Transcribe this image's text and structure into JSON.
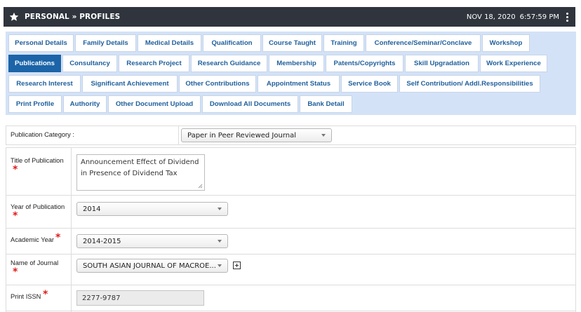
{
  "header": {
    "star_icon": "star-icon",
    "title": "PERSONAL » PROFILES",
    "date": "NOV 18, 2020",
    "time": "6:57:59 PM",
    "menu_icon": "kebab-menu-icon",
    "background": "#2f343d"
  },
  "tabs": {
    "row1": [
      "Personal Details",
      "Family Details",
      "Medical Details",
      "Qualification",
      "Course Taught",
      "Training",
      "Conference/Seminar/Conclave",
      "Workshop"
    ],
    "row2": [
      "Publications",
      "Consultancy",
      "Research Project",
      "Research Guidance",
      "Membership",
      "Patents/Copyrights",
      "Skill Upgradation",
      "Work Experience"
    ],
    "row3": [
      "Research Interest",
      "Significant Achievement",
      "Other Contributions",
      "Appointment Status",
      "Service Book",
      "Self Contribution/ Addl.Responsibilities"
    ],
    "row4": [
      "Print Profile",
      "Authority",
      "Other Document Upload",
      "Download All Documents",
      "Bank Detail"
    ],
    "active": "Publications",
    "active_color": "#1b64a8",
    "panel_color": "#d3e2f7"
  },
  "form": {
    "category": {
      "label": "Publication Category :",
      "value": "Paper in Peer Reviewed Journal"
    },
    "title": {
      "label": "Title of Publication",
      "value": "Announcement Effect of Dividend in Presence of Dividend Tax"
    },
    "year": {
      "label": "Year of Publication",
      "value": "2014"
    },
    "academic_year": {
      "label": "Academic Year",
      "value": "2014-2015"
    },
    "journal": {
      "label": "Name of Journal",
      "value": "SOUTH ASIAN JOURNAL OF MACROE..."
    },
    "issn": {
      "label": "Print ISSN",
      "value": "2277-9787"
    },
    "required_mark": "*",
    "required_color": "#e01b1b"
  }
}
